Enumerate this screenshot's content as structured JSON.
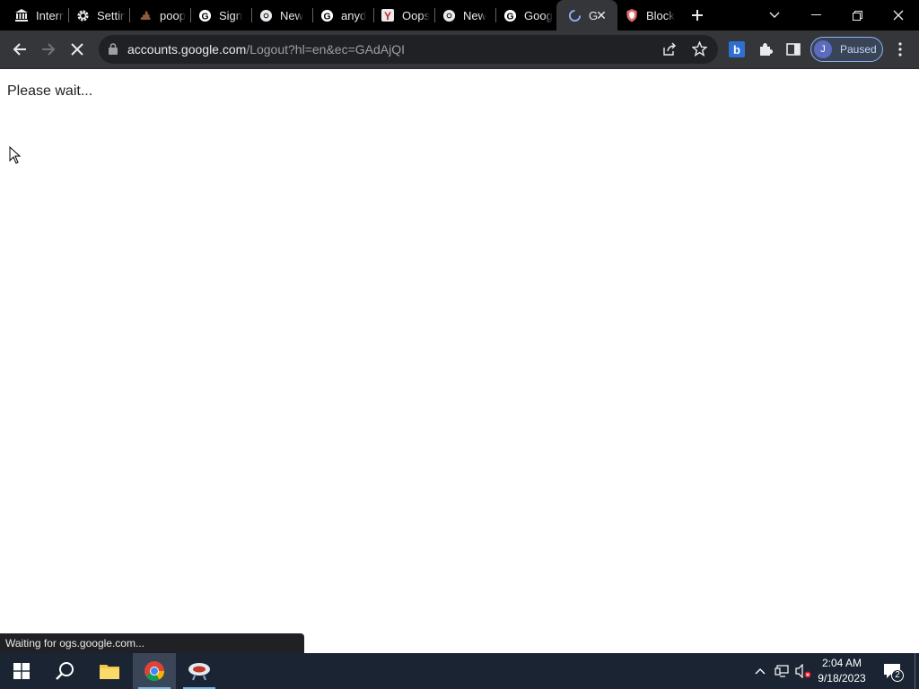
{
  "browser": {
    "tabs": [
      {
        "title": "Intern",
        "icon": "museum-icon"
      },
      {
        "title": "Settin",
        "icon": "gear-icon"
      },
      {
        "title": "poop",
        "icon": "poop-icon"
      },
      {
        "title": "Sign",
        "icon": "google-icon"
      },
      {
        "title": "New",
        "icon": "chrome-icon"
      },
      {
        "title": "anyd",
        "icon": "google-icon"
      },
      {
        "title": "Oops",
        "icon": "yandex-icon"
      },
      {
        "title": "New",
        "icon": "chrome-icon"
      },
      {
        "title": "Goog",
        "icon": "google-icon"
      },
      {
        "title": "G",
        "icon": "loading-icon",
        "active": true
      },
      {
        "title": "Block",
        "icon": "shield-icon"
      }
    ],
    "url": {
      "host": "accounts.google.com",
      "path": "/Logout?hl=en&ec=GAdAjQI"
    },
    "profile": {
      "initial": "J",
      "status": "Paused"
    }
  },
  "page": {
    "message": "Please wait..."
  },
  "status_bar": {
    "text": "Waiting for ogs.google.com..."
  },
  "taskbar": {
    "time": "2:04 AM",
    "date": "9/18/2023",
    "notification_count": "2"
  },
  "colors": {
    "tabstrip": "#000000",
    "toolbar": "#35363a",
    "omnibox": "#202124",
    "taskbar": "#1b2433",
    "accent": "#8ab4f8"
  }
}
